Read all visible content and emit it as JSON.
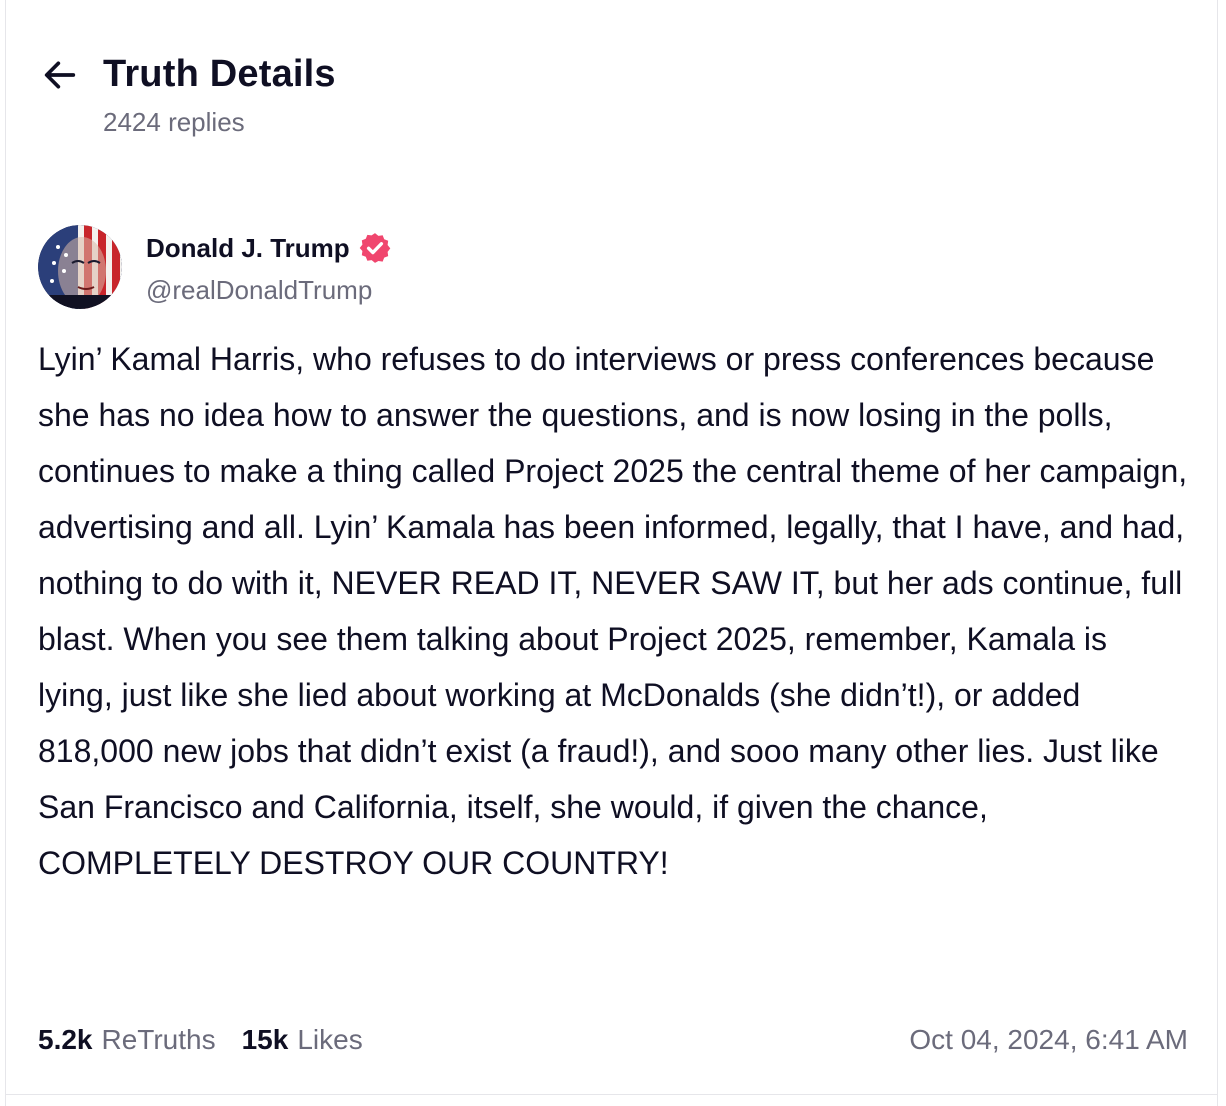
{
  "header": {
    "title": "Truth Details",
    "replies": "2424 replies"
  },
  "author": {
    "name": "Donald J. Trump",
    "handle": "@realDonaldTrump",
    "verified": true
  },
  "post": {
    "text": "Lyin’ Kamal Harris, who refuses to do interviews or press conferences because she has no idea how to answer the questions, and is now losing in the polls, continues to make a thing called Project 2025 the central theme of her campaign, advertising and all. Lyin’ Kamala has been informed, legally, that I have, and had, nothing to do with it, NEVER READ IT, NEVER SAW IT, but her ads continue, full blast. When you see them talking about Project 2025, remember, Kamala is lying, just like she lied about working at McDonalds (she didn’t!), or added 818,000 new jobs that didn’t exist (a fraud!), and sooo many other lies. Just like San Francisco and California, itself, she would, if given the chance, COMPLETELY DESTROY OUR COUNTRY!",
    "retruths_count": "5.2k",
    "retruths_label": "ReTruths",
    "likes_count": "15k",
    "likes_label": "Likes",
    "timestamp": "Oct 04, 2024, 6:41 AM"
  },
  "colors": {
    "text_primary": "#0f0f23",
    "text_secondary": "#6b6b7b",
    "verified_badge": "#f0466e",
    "border": "#e6e6ea"
  },
  "icons": {
    "back": "arrow-left-icon",
    "verified": "verified-badge-icon"
  }
}
